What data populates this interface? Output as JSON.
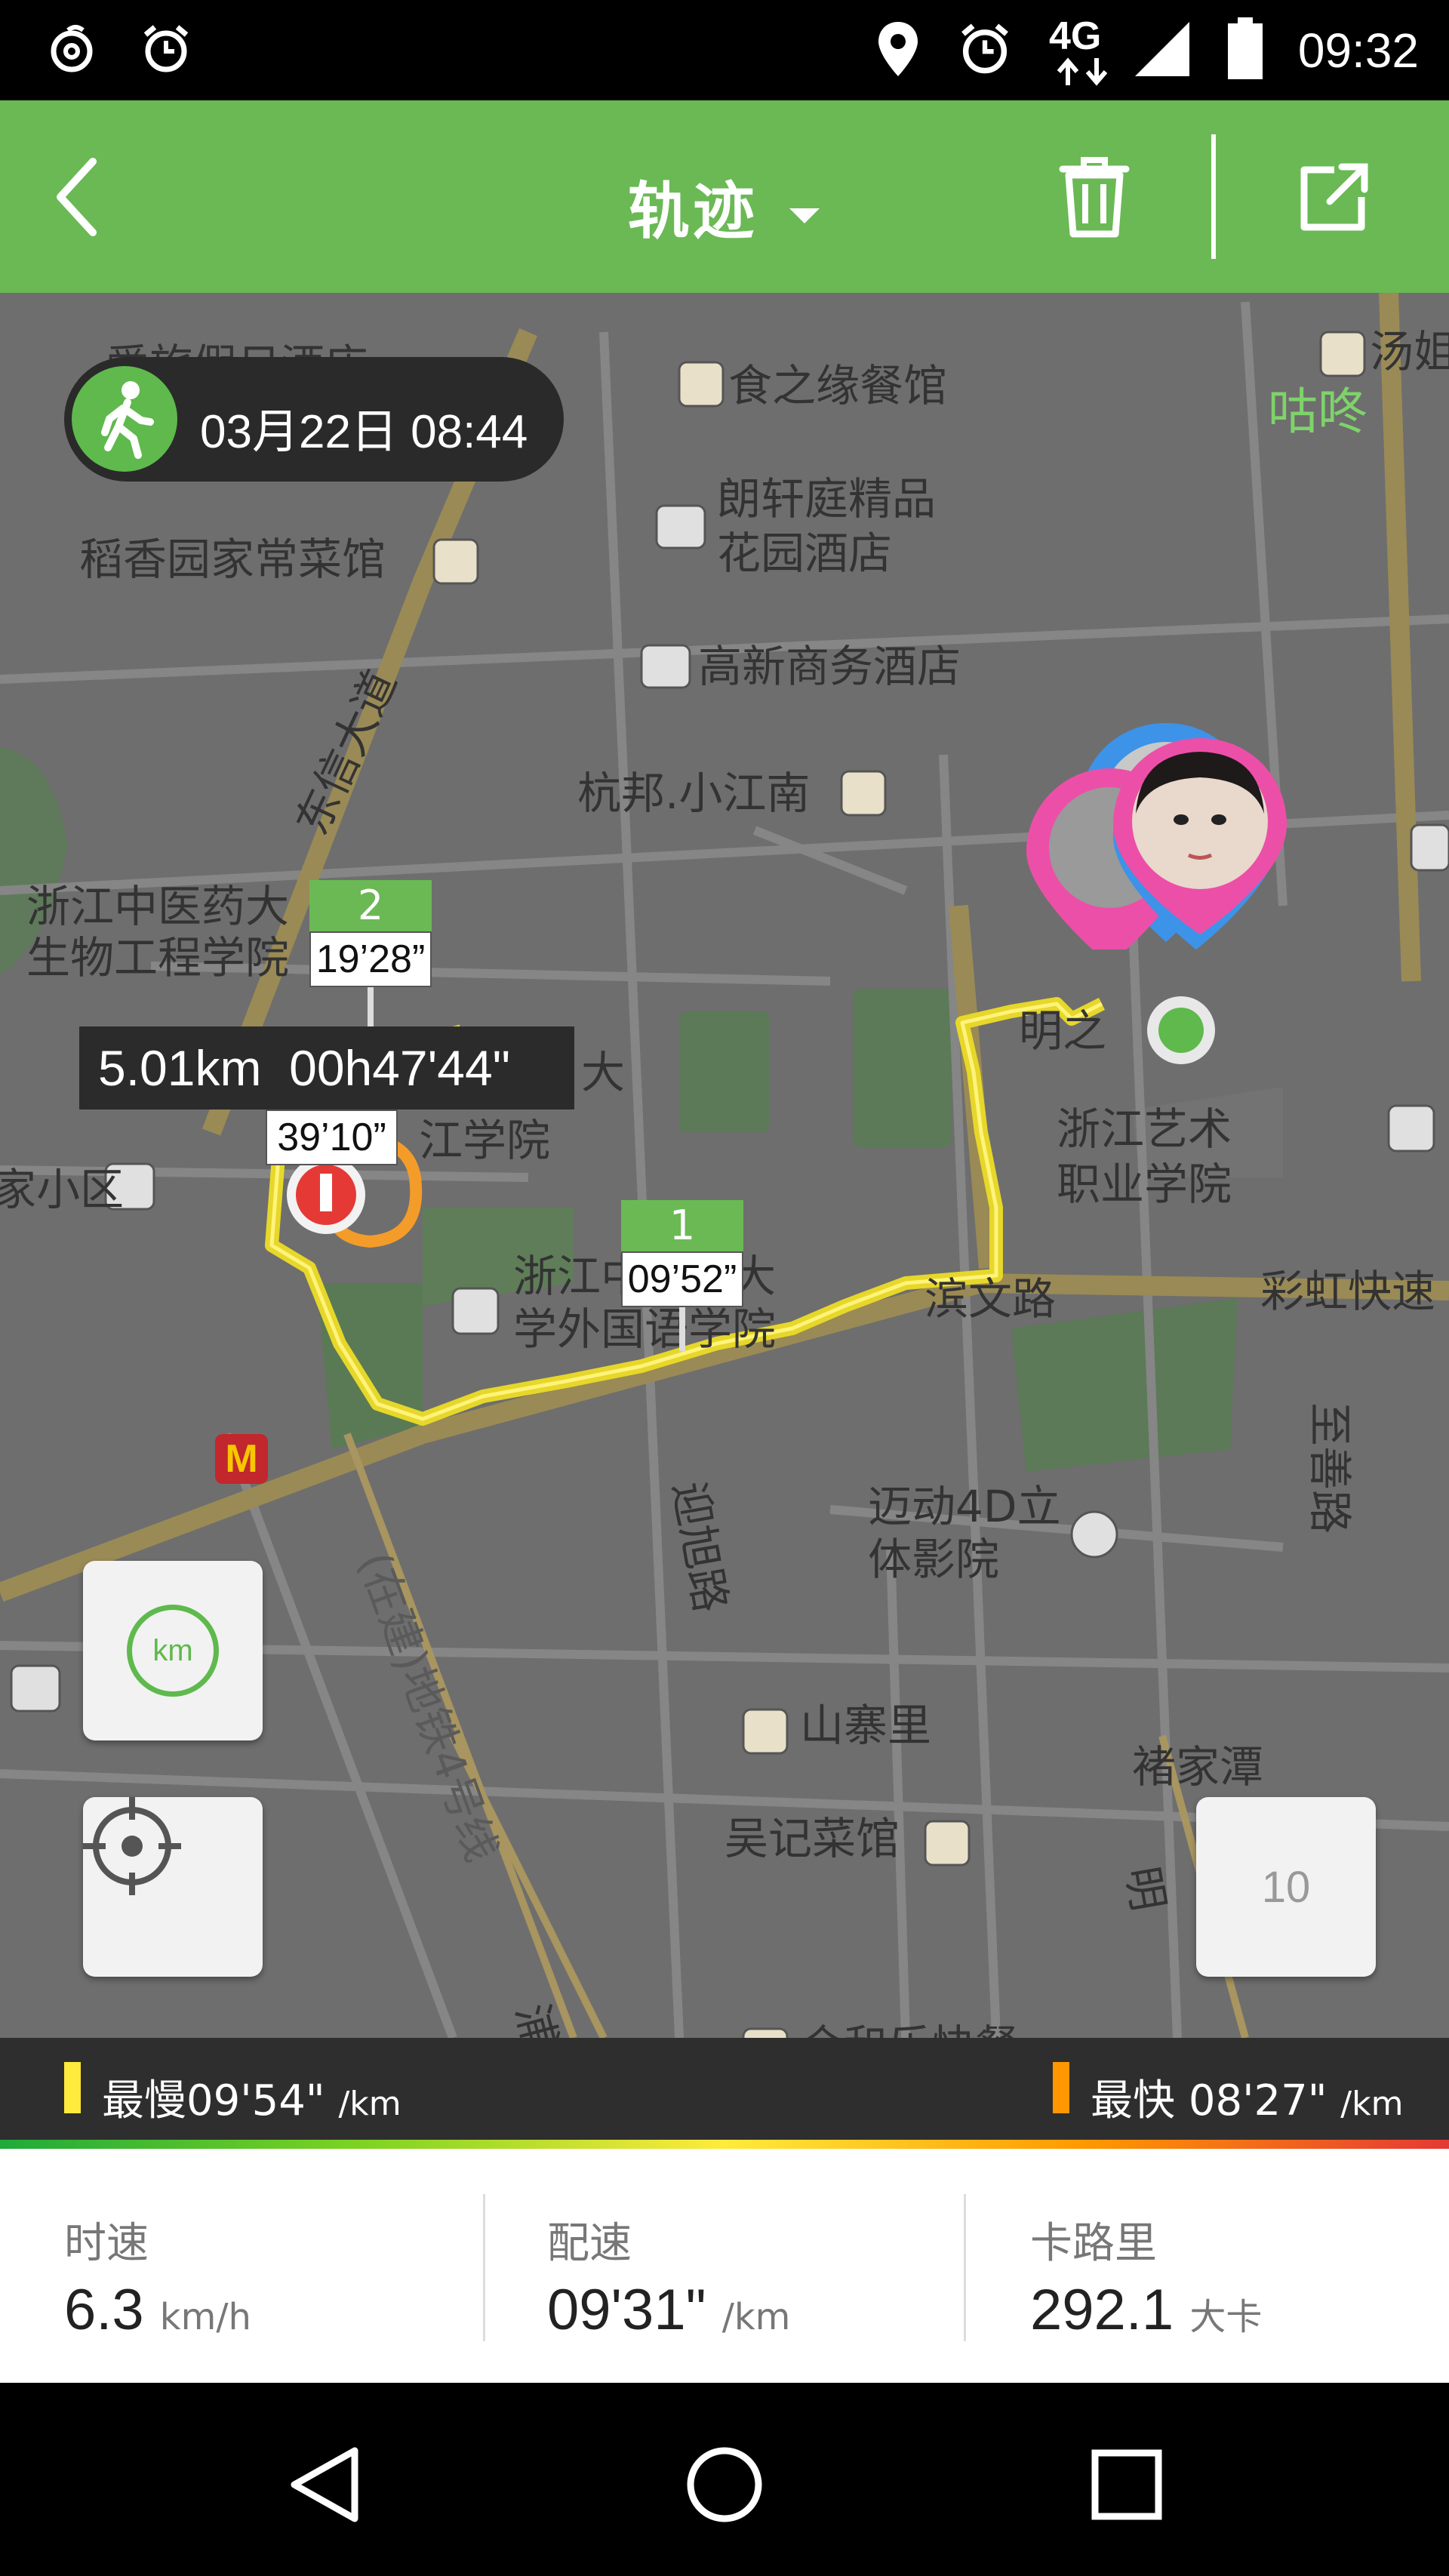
{
  "status_bar": {
    "time": "09:32",
    "network": "4G",
    "left_icons": [
      "netease-music-icon",
      "alarm-icon"
    ],
    "right_icons": [
      "location-icon",
      "alarm-icon",
      "signal-icon",
      "battery-icon"
    ]
  },
  "toolbar": {
    "title": "轨迹",
    "back_icon": "back-icon",
    "delete_icon": "trash-icon",
    "share_icon": "share-icon"
  },
  "track": {
    "date": "03月22日 08:44",
    "activity_icon": "walk-icon",
    "summary": "5.01km  00h47'44\"",
    "splits": [
      {
        "km": "1",
        "time": "09’52”"
      },
      {
        "km": "2",
        "time": "19’28”"
      },
      {
        "km": "",
        "time": "39’10”"
      }
    ]
  },
  "map": {
    "labels": {
      "hotel1": "爱旅假日酒店",
      "food1": "食之缘餐馆",
      "tang": "汤姐",
      "gudong": "咕咚",
      "langxuan1": "朗轩庭精品",
      "langxuan2": "花园酒店",
      "daoxiang": "稻香园家常菜馆",
      "gaoxin": "高新商务酒店",
      "dongxin": "东信大道",
      "hangbang": "杭邦.小江南",
      "tcm1": "浙江中医药大",
      "tcm2": "生物工程学院",
      "zjdaxue1": "大",
      "zjdaxue2": "江学院",
      "xiaoqu": "家小区",
      "zjart1": "浙江艺术",
      "zjart2": "职业学院",
      "caihong": "彩虹快速",
      "binwen": "滨文路",
      "foreign1": "浙江中医药大",
      "foreign2": "学外国语学院",
      "mingz": "明之",
      "yingxu": "迎旭路",
      "maidong1": "迈动4D立",
      "maidong2": "体影院",
      "zhishan": "至善路",
      "metro": "(在建)地铁4号线",
      "jiang": "江",
      "shanzhai": "山寨里",
      "chujia": "褚家潭",
      "wuji": "吴记菜馆",
      "heyuan": "合和乐快餐",
      "puyan": "浦沿",
      "ming2": "明"
    },
    "km_toggle_label": "km",
    "locate_icon": "crosshair-icon",
    "zoom_level": "10"
  },
  "pace": {
    "slowest_label": "最慢",
    "slowest_value": "09'54\"",
    "fastest_label": "最快",
    "fastest_value": "08'27\"",
    "unit": "/km",
    "slow_color": "#ffeb3b",
    "fast_color": "#ff9800"
  },
  "stats": [
    {
      "label": "时速",
      "value": "6.3",
      "unit": "km/h"
    },
    {
      "label": "配速",
      "value": "09'31\"",
      "unit": "/km"
    },
    {
      "label": "卡路里",
      "value": "292.1",
      "unit": "大卡"
    }
  ],
  "nav": {
    "back_icon": "nav-back-icon",
    "home_icon": "nav-home-icon",
    "recents_icon": "nav-recents-icon"
  }
}
